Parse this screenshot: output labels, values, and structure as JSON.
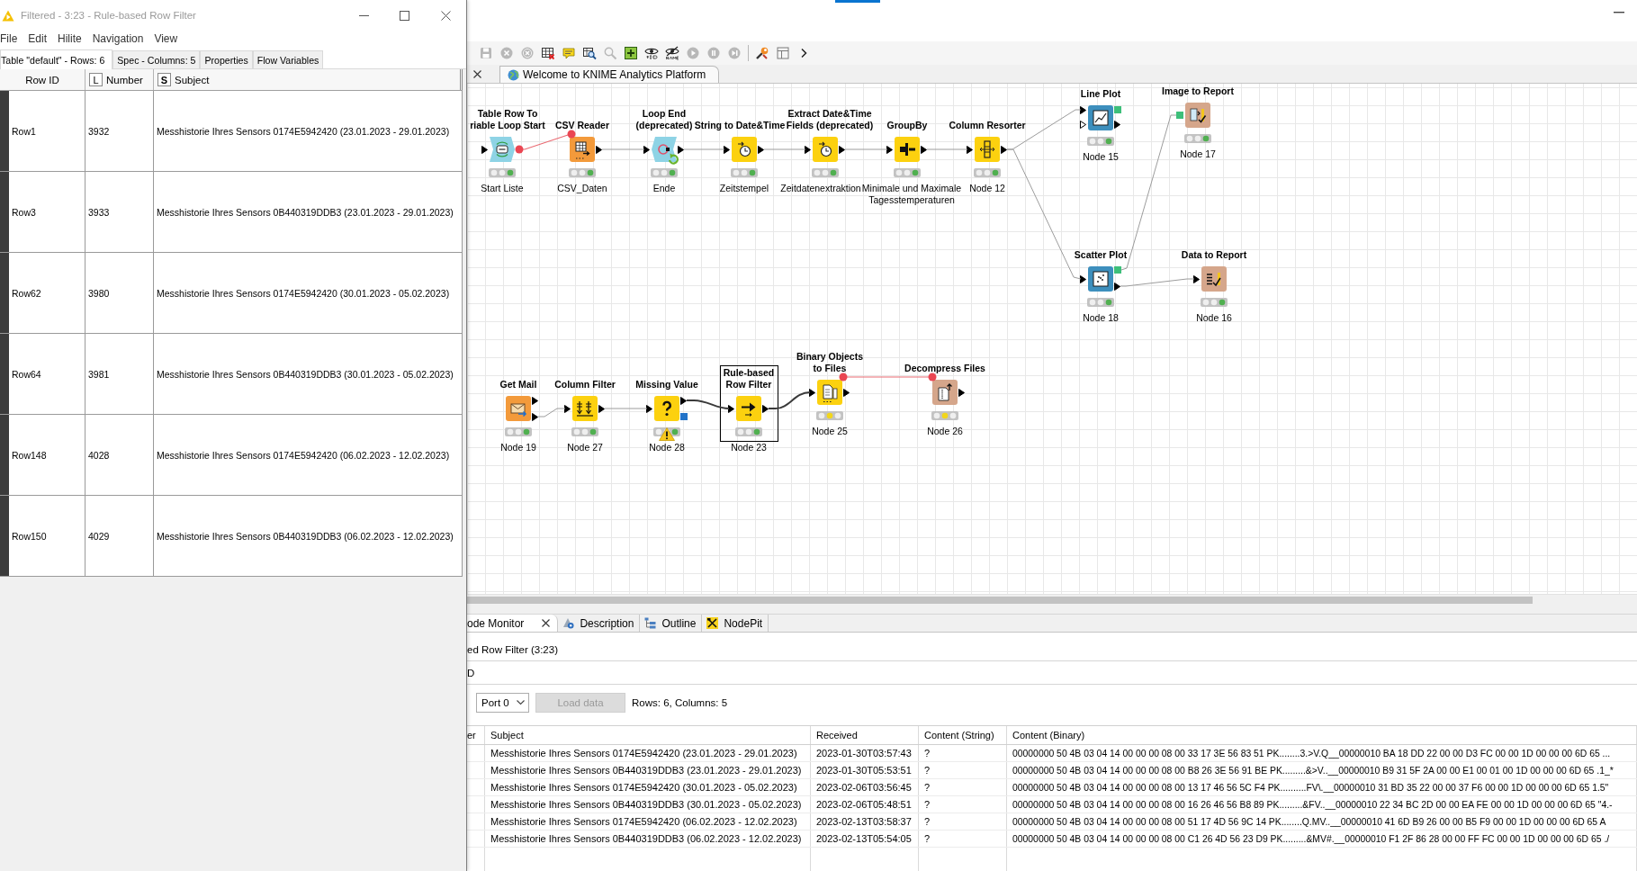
{
  "filter_window": {
    "title": "Filtered - 3:23 - Rule-based Row Filter",
    "active": false,
    "menu": [
      "File",
      "Edit",
      "Hilite",
      "Navigation",
      "View"
    ],
    "tabs": [
      {
        "label": "Table \"default\" - Rows: 6",
        "selected": true
      },
      {
        "label": "Spec - Columns: 5",
        "selected": false
      },
      {
        "label": "Properties",
        "selected": false
      },
      {
        "label": "Flow Variables",
        "selected": false
      }
    ],
    "table": {
      "columns": [
        {
          "label": "Row ID"
        },
        {
          "label": "Number",
          "type": "L"
        },
        {
          "label": "Subject",
          "type": "S"
        }
      ],
      "rows": [
        {
          "id": "Row1",
          "number": "3932",
          "subject": "Messhistorie Ihres Sensors 0174E5942420 (23.01.2023 - 29.01.2023)"
        },
        {
          "id": "Row3",
          "number": "3933",
          "subject": "Messhistorie Ihres Sensors 0B440319DDB3 (23.01.2023 - 29.01.2023)"
        },
        {
          "id": "Row62",
          "number": "3980",
          "subject": "Messhistorie Ihres Sensors 0174E5942420 (30.01.2023 - 05.02.2023)"
        },
        {
          "id": "Row64",
          "number": "3981",
          "subject": "Messhistorie Ihres Sensors 0B440319DDB3 (30.01.2023 - 05.02.2023)"
        },
        {
          "id": "Row148",
          "number": "4028",
          "subject": "Messhistorie Ihres Sensors 0174E5942420 (06.02.2023 - 12.02.2023)"
        },
        {
          "id": "Row150",
          "number": "4029",
          "subject": "Messhistorie Ihres Sensors 0B440319DDB3 (06.02.2023 - 12.02.2023)"
        }
      ]
    }
  },
  "toolbar": {
    "groups": [
      [
        {
          "kind": "save",
          "disabled": true
        },
        {
          "kind": "cancel",
          "disabled": true
        },
        {
          "kind": "cancel_all",
          "disabled": true
        },
        {
          "kind": "reset",
          "disabled": false
        },
        {
          "kind": "annotation",
          "disabled": false
        },
        {
          "kind": "open_view",
          "disabled": false
        },
        {
          "kind": "zoom",
          "disabled": true
        },
        {
          "kind": "add_metanode",
          "disabled": false
        },
        {
          "kind": "show_ids",
          "disabled": false
        },
        {
          "kind": "hide_names",
          "disabled": false
        },
        {
          "kind": "step",
          "disabled": true
        },
        {
          "kind": "pause",
          "disabled": true
        },
        {
          "kind": "resume",
          "disabled": true
        }
      ],
      [
        {
          "kind": "configure",
          "disabled": false
        },
        {
          "kind": "layout",
          "disabled": false
        },
        {
          "kind": "more",
          "disabled": false
        }
      ]
    ]
  },
  "editor_tabs": [
    {
      "label": "Welcome to KNIME Analytics Platform",
      "selected": false
    }
  ],
  "workflow": {
    "nodes": [
      {
        "title": [
          "Table Row To",
          "riable Loop Start"
        ],
        "name": [
          "Start Liste"
        ],
        "kind": "loop_start",
        "executed": true,
        "selected": false,
        "warning": false
      },
      {
        "title": [
          "CSV Reader"
        ],
        "name": [
          "CSV_Daten"
        ],
        "kind": "source",
        "executed": true,
        "selected": false,
        "warning": false
      },
      {
        "title": [
          "Loop End",
          "(deprecated)"
        ],
        "name": [
          "Ende"
        ],
        "kind": "loop_end",
        "executed": true,
        "selected": false,
        "warning": false
      },
      {
        "title": [
          "String to Date&Time"
        ],
        "name": [
          "Zeitstempel"
        ],
        "kind": "manipulator",
        "executed": true,
        "selected": false,
        "warning": false
      },
      {
        "title": [
          "Extract Date&Time",
          "Fields (deprecated)"
        ],
        "name": [
          "Zeitdatenextraktion"
        ],
        "kind": "manipulator",
        "executed": true,
        "selected": false,
        "warning": false
      },
      {
        "title": [
          "GroupBy"
        ],
        "name": [
          "Minimale und Maximale",
          "Tagesstemperaturen"
        ],
        "kind": "manipulator",
        "executed": true,
        "selected": false,
        "warning": false
      },
      {
        "title": [
          "Column Resorter"
        ],
        "name": [
          "Node 12"
        ],
        "kind": "manipulator",
        "executed": true,
        "selected": false,
        "warning": false
      },
      {
        "title": [
          "Line Plot"
        ],
        "name": [
          "Node 15"
        ],
        "kind": "visualizer",
        "executed": true,
        "selected": false,
        "warning": false
      },
      {
        "title": [
          "Image to Report"
        ],
        "name": [
          "Node 17"
        ],
        "kind": "other",
        "executed": true,
        "selected": false,
        "warning": false
      },
      {
        "title": [
          "Scatter Plot"
        ],
        "name": [
          "Node 18"
        ],
        "kind": "visualizer",
        "executed": true,
        "selected": false,
        "warning": false
      },
      {
        "title": [
          "Data to Report"
        ],
        "name": [
          "Node 16"
        ],
        "kind": "other",
        "executed": true,
        "selected": false,
        "warning": false
      },
      {
        "title": [
          "Get Mail"
        ],
        "name": [
          "Node 19"
        ],
        "kind": "source",
        "executed": true,
        "selected": false,
        "warning": false
      },
      {
        "title": [
          "Column Filter"
        ],
        "name": [
          "Node 27"
        ],
        "kind": "manipulator",
        "executed": true,
        "selected": false,
        "warning": false
      },
      {
        "title": [
          "Missing Value"
        ],
        "name": [
          "Node 28"
        ],
        "kind": "manipulator",
        "executed": true,
        "selected": false,
        "warning": true
      },
      {
        "title": [
          "Rule-based",
          "Row Filter"
        ],
        "name": [
          "Node 23"
        ],
        "kind": "manipulator",
        "executed": true,
        "selected": true,
        "warning": false
      },
      {
        "title": [
          "Binary Objects",
          "to Files"
        ],
        "name": [
          "Node 25"
        ],
        "kind": "manipulator",
        "executed": false,
        "selected": false,
        "warning": false
      },
      {
        "title": [
          "Decompress Files"
        ],
        "name": [
          "Node 26"
        ],
        "kind": "other",
        "executed": false,
        "selected": false,
        "warning": false
      }
    ]
  },
  "bottom_panel": {
    "tabs": [
      {
        "label": "ode Monitor",
        "kind": "monitor",
        "selected": true,
        "closable": true
      },
      {
        "label": "Description",
        "kind": "description",
        "selected": false,
        "closable": false
      },
      {
        "label": "Outline",
        "kind": "outline",
        "selected": false,
        "closable": false
      },
      {
        "label": "NodePit",
        "kind": "nodepit",
        "selected": false,
        "closable": false
      }
    ],
    "node_label": "ed Row Filter (3:23)",
    "label_2": "D",
    "port": "Port 0",
    "load_button": {
      "label": "Load data",
      "disabled": true
    },
    "summary": "Rows: 6, Columns: 5",
    "table": {
      "columns": [
        "er",
        "Subject",
        "Received",
        "Content (String)",
        "Content (Binary)"
      ],
      "rows": [
        {
          "subject": "Messhistorie Ihres Sensors 0174E5942420 (23.01.2023 - 29.01.2023)",
          "received": "2023-01-30T03:57:43",
          "content_string": "?",
          "content_binary": "00000000 50 4B 03 04 14 00 00 00 08 00 33 17 3E 56 83 51 PK........3.>V.Q__00000010 BA 18 DD 22 00 00 D3 FC 00 00 1D 00 00 00 6D 65 ..."
        },
        {
          "subject": "Messhistorie Ihres Sensors 0B440319DDB3 (23.01.2023 - 29.01.2023)",
          "received": "2023-01-30T05:53:51",
          "content_string": "?",
          "content_binary": "00000000 50 4B 03 04 14 00 00 00 08 00 B8 26 3E 56 91 BE PK.........&>V..__00000010 B9 31 5F 2A 00 00 E1 00 01 00 1D 00 00 00 6D 65 .1_*"
        },
        {
          "subject": "Messhistorie Ihres Sensors 0174E5942420 (30.01.2023 - 05.02.2023)",
          "received": "2023-02-06T03:56:45",
          "content_string": "?",
          "content_binary": "00000000 50 4B 03 04 14 00 00 00 08 00 13 17 46 56 5C F4 PK..........FV\\.__00000010 31 BD 35 22 00 00 37 F6 00 00 1D 00 00 00 6D 65 1.5\""
        },
        {
          "subject": "Messhistorie Ihres Sensors 0B440319DDB3 (30.01.2023 - 05.02.2023)",
          "received": "2023-02-06T05:48:51",
          "content_string": "?",
          "content_binary": "00000000 50 4B 03 04 14 00 00 00 08 00 16 26 46 56 B8 89 PK.........&FV..__00000010 22 34 BC 2D 00 00 EA FE 00 00 1D 00 00 00 6D 65 \"4.-"
        },
        {
          "subject": "Messhistorie Ihres Sensors 0174E5942420 (06.02.2023 - 12.02.2023)",
          "received": "2023-02-13T03:58:37",
          "content_string": "?",
          "content_binary": "00000000 50 4B 03 04 14 00 00 00 08 00 51 17 4D 56 9C 14 PK........Q.MV..__00000010 41 6D B9 26 00 00 B5 F9 00 00 1D 00 00 00 6D 65 A"
        },
        {
          "subject": "Messhistorie Ihres Sensors 0B440319DDB3 (06.02.2023 - 12.02.2023)",
          "received": "2023-02-13T05:54:05",
          "content_string": "?",
          "content_binary": "00000000 50 4B 03 04 14 00 00 00 08 00 C1 26 4D 56 23 D9 PK.........&MV#.__00000010 F1 2F 86 28 00 00 FF FC 00 00 1D 00 00 00 6D 65 ./"
        }
      ]
    }
  }
}
